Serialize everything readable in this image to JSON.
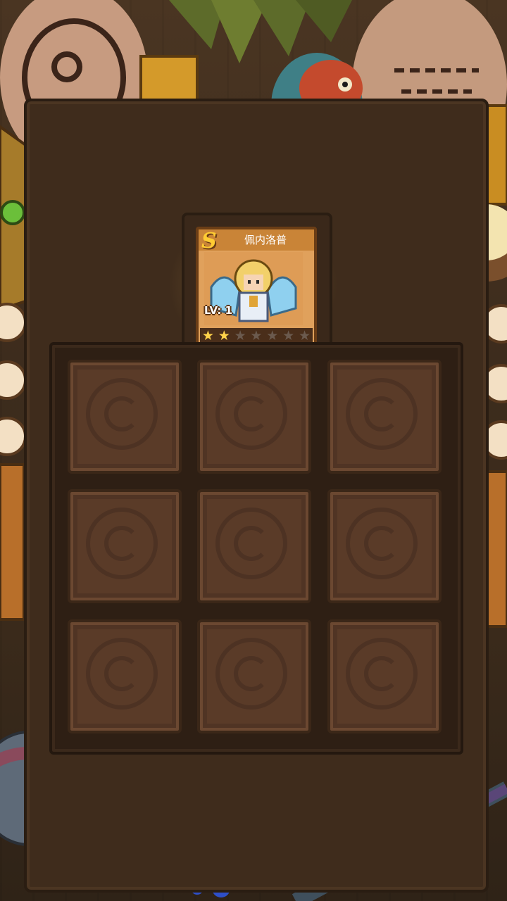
{
  "hero_card": {
    "rank": "S",
    "name": "佩内洛普",
    "level_text": "LV: 1",
    "stars_filled": 2,
    "stars_total": 7
  },
  "grid": {
    "rows": 3,
    "cols": 3,
    "empty_slots": 9
  },
  "colors": {
    "card_border": "#6a3d16",
    "star_on": "#ffd34a",
    "star_off": "#6b5a4e",
    "slot": "#5a3b28",
    "table": "#3f2c1c"
  }
}
